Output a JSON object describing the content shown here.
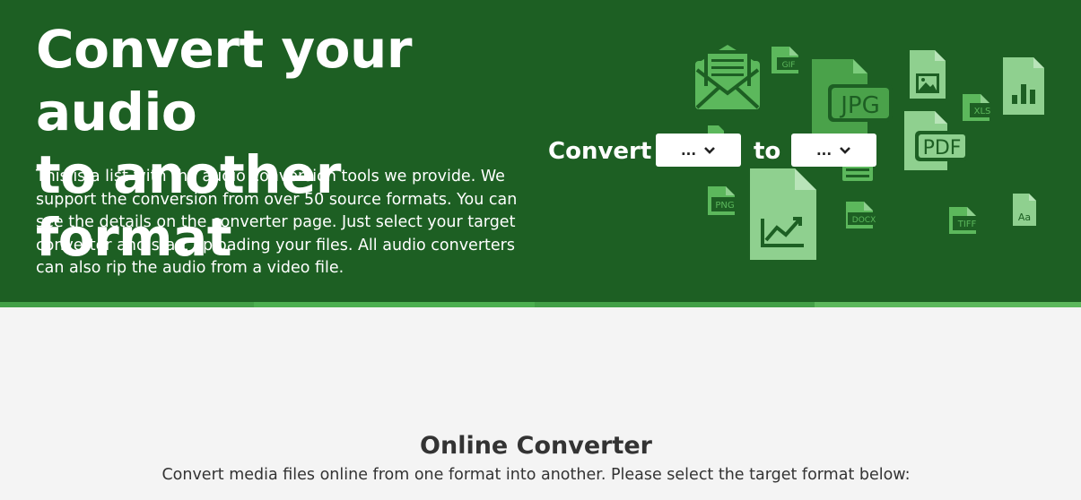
{
  "hero": {
    "title_line1": "Convert your audio",
    "title_line2": "to another format",
    "description": "This is a list with the audio conversion tools we provide. We support the conversion from over 50 source formats. You can see the details on the converter page. Just select your target converter and start uploading your files. All audio converters can also rip the audio from a video file."
  },
  "converter": {
    "convert_label": "Convert",
    "to_label": "to",
    "from_select_value": "...",
    "to_select_value": "..."
  },
  "illustration": {
    "labels": {
      "gif": "GIF",
      "jpg": "JPG",
      "xls": "XLS",
      "pdf": "PDF",
      "png": "PNG",
      "docx": "DOCX",
      "tiff": "TIFF",
      "font": "Aa"
    }
  },
  "main": {
    "title": "Online Converter",
    "subtitle": "Convert media files online from one format into another. Please select the target format below:"
  },
  "colors": {
    "hero_bg": "#1d5f23",
    "icon_green": "#5cb85c",
    "stripe": "#4caf50",
    "page_bg": "#f4f4f4"
  }
}
